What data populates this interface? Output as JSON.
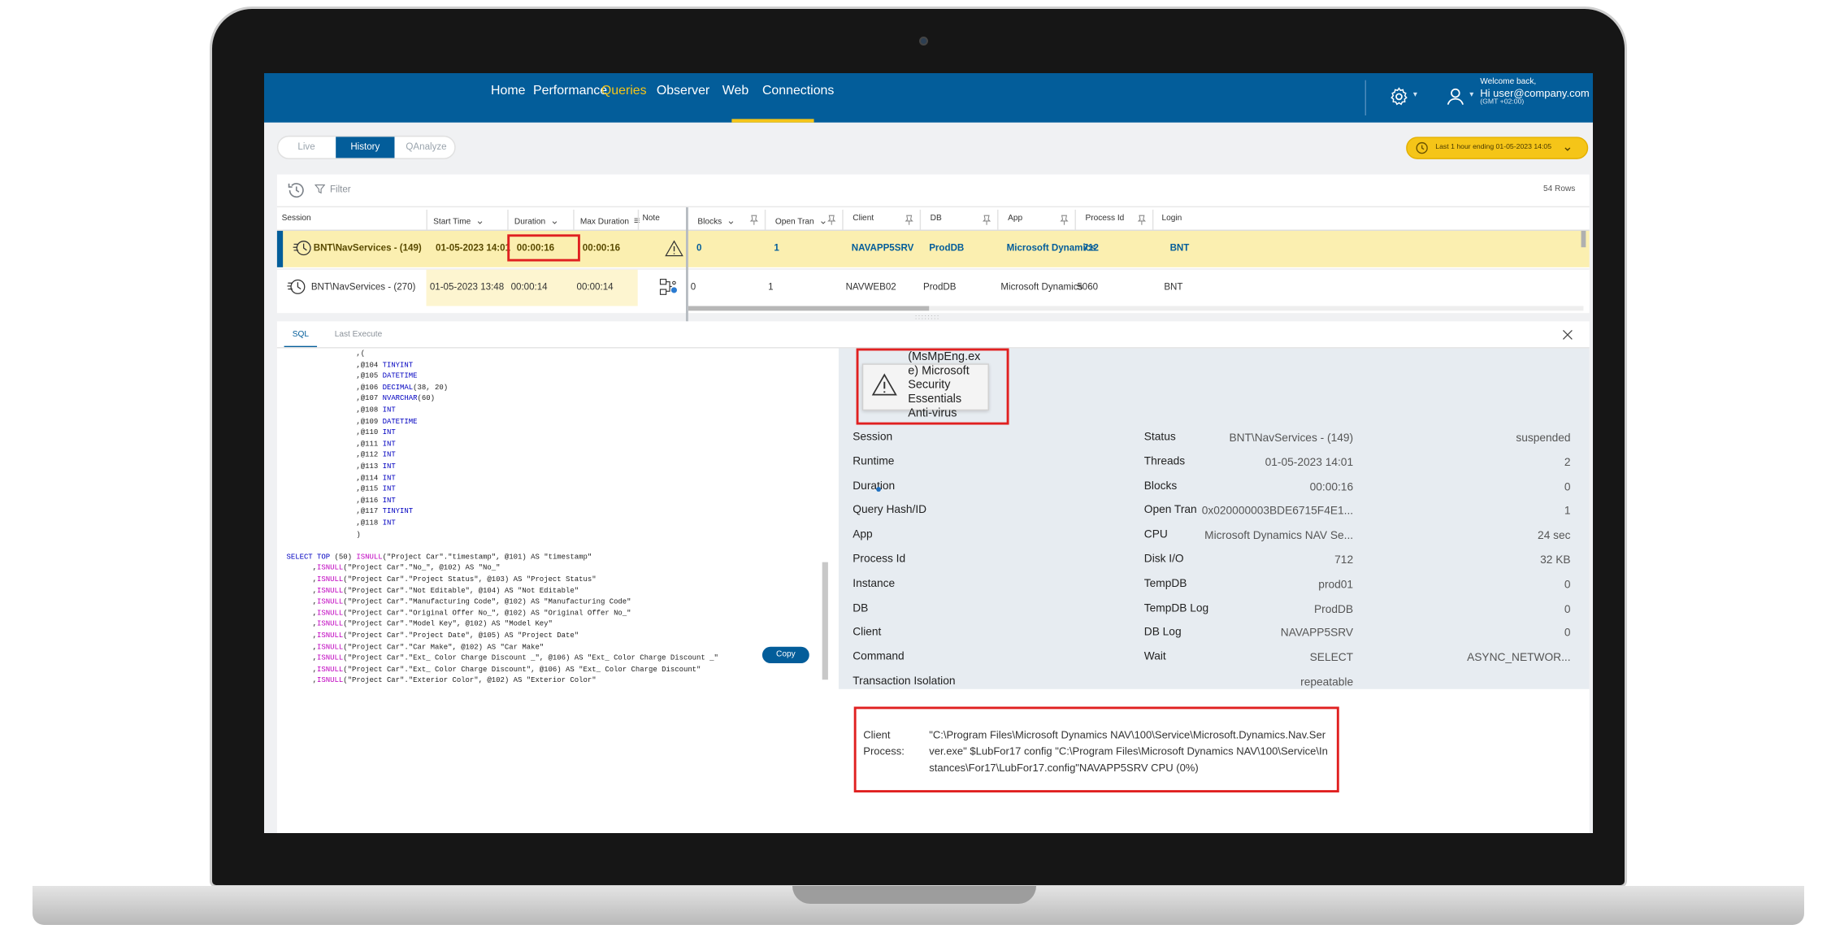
{
  "nav": {
    "items": [
      "Home",
      "Performance",
      "Queries",
      "Observer",
      "Web",
      "Connections"
    ],
    "active": "Queries"
  },
  "user": {
    "welcome": "Welcome back,",
    "email": "Hi user@company.com",
    "timezone": "(GMT +02:00)"
  },
  "modes": {
    "live": "Live",
    "history": "History",
    "qanalyze": "QAnalyze"
  },
  "time_range": "Last 1 hour ending  01-05-2023 14:05",
  "toolbar": {
    "filter": "Filter",
    "rows": "54 Rows"
  },
  "columns": {
    "session": "Session",
    "start_time": "Start Time",
    "duration": "Duration",
    "max_duration": "Max Duration",
    "note": "Note",
    "blocks": "Blocks",
    "open_tran": "Open Tran",
    "client": "Client",
    "db": "DB",
    "app": "App",
    "process_id": "Process Id",
    "login": "Login"
  },
  "rows": [
    {
      "session": "BNT\\NavServices - (149)",
      "start_time": "01-05-2023 14:01",
      "duration": "00:00:16",
      "max_duration": "00:00:16",
      "blocks": "0",
      "open_tran": "1",
      "client": "NAVAPP5SRV",
      "db": "ProdDB",
      "app": "Microsoft Dynamics",
      "process_id": "712",
      "login": "BNT"
    },
    {
      "session": "BNT\\NavServices - (270)",
      "start_time": "01-05-2023 13:48",
      "duration": "00:00:14",
      "max_duration": "00:00:14",
      "blocks": "0",
      "open_tran": "1",
      "client": "NAVWEB02",
      "db": "ProdDB",
      "app": "Microsoft Dynamics",
      "process_id": "5060",
      "login": "BNT"
    }
  ],
  "detail_tabs": {
    "sql": "SQL",
    "last_execute": "Last Execute"
  },
  "copy": "Copy",
  "sql_lines": [
    {
      "i": "                ,(",
      "k": "",
      "r": ""
    },
    {
      "i": "                ,@104 ",
      "k": "TINYINT",
      "r": ""
    },
    {
      "i": "                ,@105 ",
      "k": "DATETIME",
      "r": ""
    },
    {
      "i": "                ,@106 ",
      "k": "DECIMAL",
      "r": "(38, 20)"
    },
    {
      "i": "                ,@107 ",
      "k": "NVARCHAR",
      "r": "(60)"
    },
    {
      "i": "                ,@108 ",
      "k": "INT",
      "r": ""
    },
    {
      "i": "                ,@109 ",
      "k": "DATETIME",
      "r": ""
    },
    {
      "i": "                ,@110 ",
      "k": "INT",
      "r": ""
    },
    {
      "i": "                ,@111 ",
      "k": "INT",
      "r": ""
    },
    {
      "i": "                ,@112 ",
      "k": "INT",
      "r": ""
    },
    {
      "i": "                ,@113 ",
      "k": "INT",
      "r": ""
    },
    {
      "i": "                ,@114 ",
      "k": "INT",
      "r": ""
    },
    {
      "i": "                ,@115 ",
      "k": "INT",
      "r": ""
    },
    {
      "i": "                ,@116 ",
      "k": "INT",
      "r": ""
    },
    {
      "i": "                ,@117 ",
      "k": "TINYINT",
      "r": ""
    },
    {
      "i": "                ,@118 ",
      "k": "INT",
      "r": ""
    },
    {
      "i": "                )",
      "k": "",
      "r": ""
    }
  ],
  "sql_select": [
    "(\"Project Car\".\"No_\", @102) AS \"No_\"",
    "(\"Project Car\".\"Project Status\", @103) AS \"Project Status\"",
    "(\"Project Car\".\"Not Editable\", @104) AS \"Not Editable\"",
    "(\"Project Car\".\"Manufacturing Code\", @102) AS \"Manufacturing Code\"",
    "(\"Project Car\".\"Original Offer No_\", @102) AS \"Original Offer No_\"",
    "(\"Project Car\".\"Model Key\", @102) AS \"Model Key\"",
    "(\"Project Car\".\"Project Date\", @105) AS \"Project Date\"",
    "(\"Project Car\".\"Car Make\", @102) AS \"Car Make\"",
    "(\"Project Car\".\"Ext_ Color Charge Discount _\", @106) AS \"Ext_ Color Charge Discount _\"",
    "(\"Project Car\".\"Ext_ Color Charge Discount\", @106) AS \"Ext_ Color Charge Discount\"",
    "(\"Project Car\".\"Exterior Color\", @102) AS \"Exterior Color\""
  ],
  "sql_first_select": "(50) ISNULL(\"Project Car\".\"timestamp\", @101) AS \"timestamp\"",
  "tooltip_lines": [
    "(MsMpEng.ex",
    "e) Microsoft",
    "Security",
    "Essentials",
    "Anti-virus"
  ],
  "details_left": [
    {
      "k": "Session",
      "v": "BNT\\NavServices - (149)"
    },
    {
      "k": "Runtime",
      "v": "01-05-2023 14:01"
    },
    {
      "k": "Duration",
      "v": "00:00:16"
    },
    {
      "k": "Query Hash/ID",
      "v": "0x020000003BDE6715F4E1..."
    },
    {
      "k": "App",
      "v": "Microsoft Dynamics NAV Se..."
    },
    {
      "k": "Process Id",
      "v": "712"
    },
    {
      "k": "Instance",
      "v": "prod01"
    },
    {
      "k": "DB",
      "v": "ProdDB"
    },
    {
      "k": "Client",
      "v": "NAVAPP5SRV"
    },
    {
      "k": "Command",
      "v": "SELECT"
    },
    {
      "k": "Transaction Isolation",
      "v": "repeatable"
    }
  ],
  "details_right": [
    {
      "k": "Status",
      "v": "suspended"
    },
    {
      "k": "Threads",
      "v": "2"
    },
    {
      "k": "Blocks",
      "v": "0"
    },
    {
      "k": "Open Tran",
      "v": "1"
    },
    {
      "k": "CPU",
      "v": "24 sec"
    },
    {
      "k": "Disk I/O",
      "v": "32 KB"
    },
    {
      "k": "TempDB",
      "v": "0"
    },
    {
      "k": "TempDB Log",
      "v": "0"
    },
    {
      "k": "DB Log",
      "v": "0"
    },
    {
      "k": "Wait",
      "v": "ASYNC_NETWOR..."
    }
  ],
  "client_process": {
    "label": "Client Process:",
    "text": "\"C:\\Program Files\\Microsoft Dynamics NAV\\100\\Service\\Microsoft.Dynamics.Nav.Server.exe\" $LubFor17 config \"C:\\Program Files\\Microsoft Dynamics NAV\\100\\Service\\Instances\\For17\\LubFor17.config\"NAVAPP5SRV CPU  (0%)"
  },
  "colors": {
    "brand": "#035d9a",
    "accent": "#f5c518",
    "highlight_row": "#fbefb0",
    "alert_box": "#e02020"
  },
  "icons": [
    "gear-icon",
    "user-icon",
    "clock-icon",
    "history-icon",
    "filter-icon",
    "pin-icon",
    "session-icon",
    "warning-icon",
    "plan-icon",
    "close-icon"
  ]
}
